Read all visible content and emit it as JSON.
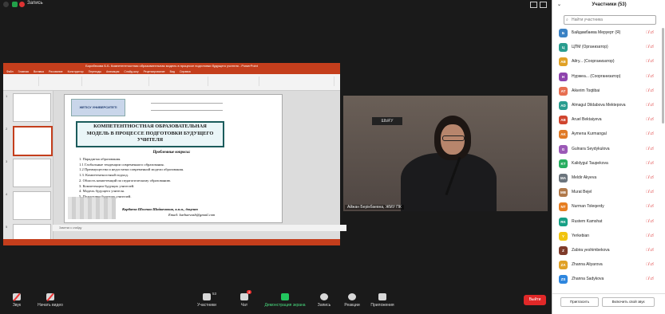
{
  "topbar": {
    "recording_label": "Запись"
  },
  "ppt": {
    "window_title": "Борибекова Б.Б. Компетентностная образовательная модель в процессе подготовки будущего учителя - PowerPoint",
    "tabs": [
      "Файл",
      "Главная",
      "Вставка",
      "Рисование",
      "Конструктор",
      "Переходы",
      "Анимация",
      "Слайд-шоу",
      "Рецензирование",
      "Вид",
      "Справка"
    ],
    "slide_numbers": [
      "1",
      "2",
      "3",
      "4",
      "5"
    ],
    "notes_placeholder": "Заметки к слайду"
  },
  "slide": {
    "logo_text": "ЖЕТІСУ УНИВЕРСИТЕТІ",
    "title_lines": [
      "КОМПЕТЕНТНОСТНАЯ ОБРАЗОВАТЕЛЬНАЯ",
      "МОДЕЛЬ В ПРОЦЕССЕ ПОДГОТОВКИ БУДУЩЕГО",
      "УЧИТЕЛЯ"
    ],
    "subtitle": "Проблемные вопросы:",
    "items": [
      "1. Парадигма образования.",
      "1.1 Глобальные тенденции  современного образования.",
      "1.2 Преимущества и недостатки современной модели образования.",
      "1.3. Компетентностный  подход.",
      "2. Область компетенций по педагогическому образованию.",
      "3. Компетенции будущих учителей.",
      "4. Модель  будущего  учителя.",
      "5. Подготовка будущих учителей."
    ],
    "author": "Карбаева Шолпан Шайкеновна, к.п.н., доцент",
    "email": "Email: karbaevash@gmail.com"
  },
  "camera": {
    "sign_text": "ШЫҒУ",
    "speaker_label": "Айжан Берікбаевна, ЖМУ ПК"
  },
  "toolbar": {
    "mute": "Звук",
    "video": "Начать видео",
    "participants": "Участники",
    "participants_count": "53",
    "chat": "Чат",
    "chat_badge": "4",
    "share": "Демонстрация экрана",
    "record": "Запись",
    "reactions": "Реакции",
    "apps": "Приложения",
    "leave": "Выйти"
  },
  "participants_panel": {
    "title": "Участники (53)",
    "search_placeholder": "Найти участника",
    "invite": "Пригласить",
    "unmute_me": "Включить свой звук",
    "participants": [
      {
        "initials": "Б",
        "name": "Байдамбаева Меруерт (Я)",
        "color": "#3b82c4"
      },
      {
        "initials": "Ц",
        "name": "ЦПМ (Организатор)",
        "color": "#2a9d8f"
      },
      {
        "initials": "AB",
        "name": "Айгу... (Соорганизатор)",
        "color": "#e0a126"
      },
      {
        "initials": "Н",
        "name": "Нуржеа... (Соорганизатор)",
        "color": "#8e44ad"
      },
      {
        "initials": "AT",
        "name": "Aikerim Toqtibai",
        "color": "#e76f51"
      },
      {
        "initials": "AD",
        "name": "Almagul Dildabova Mektepova",
        "color": "#2a9d8f"
      },
      {
        "initials": "AB",
        "name": "Aruel Bektaiyeva",
        "color": "#d0452f"
      },
      {
        "initials": "AK",
        "name": "Aymena Kurmangal",
        "color": "#e07a26"
      },
      {
        "initials": "G",
        "name": "Gulnara Seydykulova",
        "color": "#9b59b6"
      },
      {
        "initials": "KT",
        "name": "Kalidygul Taupekova",
        "color": "#27ae60"
      },
      {
        "initials": "MA",
        "name": "Meldir Akyeva",
        "color": "#6c757d"
      },
      {
        "initials": "MB",
        "name": "Murat Bejel",
        "color": "#b0794a"
      },
      {
        "initials": "NT",
        "name": "Nurman Toleqerdy",
        "color": "#e67e22"
      },
      {
        "initials": "RK",
        "name": "Rustem Kamshat",
        "color": "#16a085"
      },
      {
        "initials": "Y",
        "name": "Yerkebian",
        "color": "#f1c40f"
      },
      {
        "initials": "Z",
        "name": "Zabira yeshimbekova",
        "color": "#7f3b2a"
      },
      {
        "initials": "ZA",
        "name": "Zhanna Aliyarova",
        "color": "#e0a126"
      },
      {
        "initials": "ZS",
        "name": "Zhanna Sadykova",
        "color": "#2e86de"
      }
    ]
  }
}
